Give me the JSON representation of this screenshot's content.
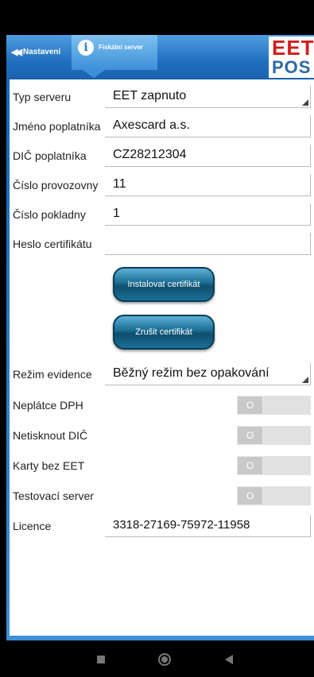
{
  "header": {
    "back_label": "Nastavení",
    "active_tab_label": "Fiskální server",
    "logo_top": "EET",
    "logo_bottom": "POS"
  },
  "form": {
    "server_type": {
      "label": "Typ serveru",
      "value": "EET zapnuto"
    },
    "taxpayer_name": {
      "label": "Jméno poplatníka",
      "value": "Axescard a.s."
    },
    "taxpayer_dic": {
      "label": "DIČ poplatníka",
      "value": "CZ28212304"
    },
    "premises_number": {
      "label": "Číslo provozovny",
      "value": "11"
    },
    "register_number": {
      "label": "Číslo pokladny",
      "value": "1"
    },
    "certificate_password": {
      "label": "Heslo certifikátu",
      "value": ""
    },
    "install_cert_button": "Instalovat certifikát",
    "cancel_cert_button": "Zrušit certifikát",
    "evidence_mode": {
      "label": "Režim evidence",
      "value": "Běžný režim bez opakování"
    },
    "non_vat_payer": {
      "label": "Neplátce DPH",
      "toggle": "O",
      "on": false
    },
    "no_print_dic": {
      "label": "Netisknout DIČ",
      "toggle": "O",
      "on": false
    },
    "cards_without_eet": {
      "label": "Karty bez EET",
      "toggle": "O",
      "on": false
    },
    "test_server": {
      "label": "Testovací server",
      "toggle": "O",
      "on": false
    },
    "license": {
      "label": "Licence",
      "value": "3318-27169-75972-11958"
    }
  },
  "colors": {
    "header_blue": "#1f6fbf",
    "logo_red": "#d21b1b",
    "logo_blue": "#2b6aa7",
    "button_teal": "#1a6c93"
  }
}
